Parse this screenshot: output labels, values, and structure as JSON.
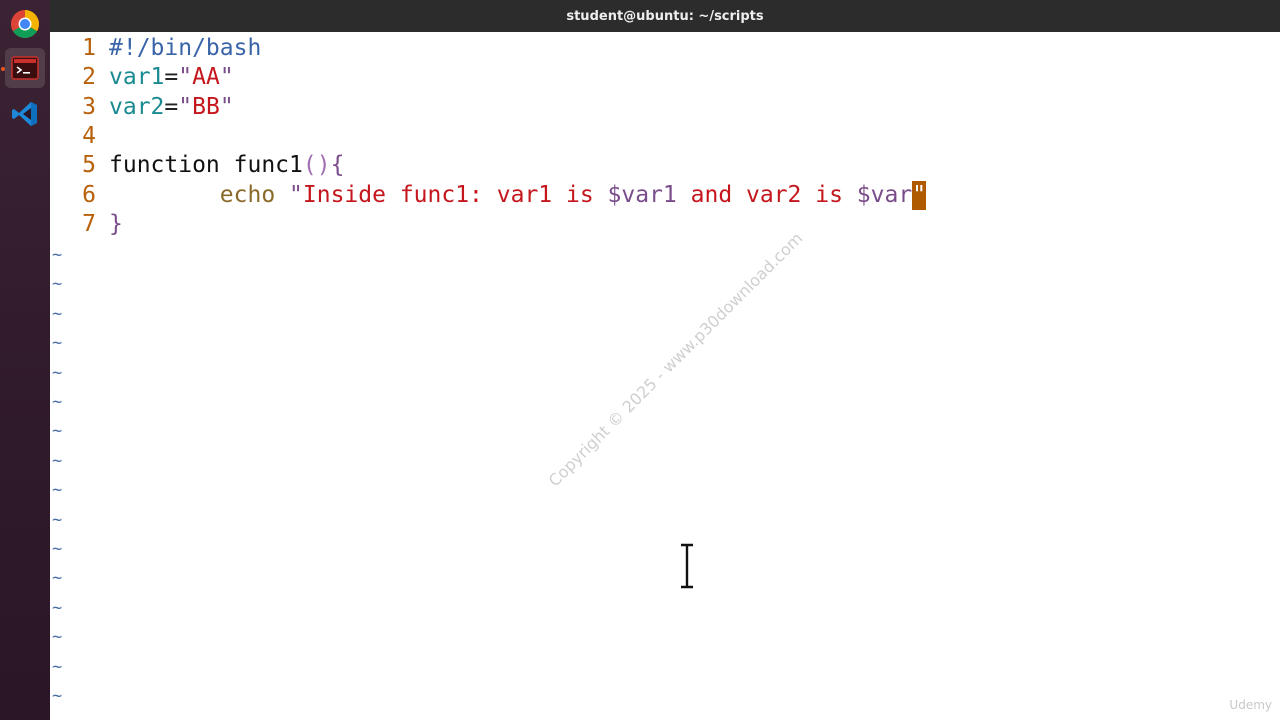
{
  "window": {
    "title": "student@ubuntu: ~/scripts"
  },
  "dock": {
    "items": [
      {
        "name": "Chrome",
        "icon": "chrome-icon"
      },
      {
        "name": "Terminal",
        "icon": "terminal-icon",
        "active": true
      },
      {
        "name": "Visual Studio Code",
        "icon": "vscode-icon"
      }
    ]
  },
  "editor": {
    "lines": [
      {
        "number": "1",
        "tokens": [
          {
            "text": "#!/bin/bash",
            "cls": "c-comment"
          }
        ]
      },
      {
        "number": "2",
        "tokens": [
          {
            "text": "var1",
            "cls": "c-var"
          },
          {
            "text": "=",
            "cls": "c-op"
          },
          {
            "text": "\"",
            "cls": "c-quote"
          },
          {
            "text": "AA",
            "cls": "c-str"
          },
          {
            "text": "\"",
            "cls": "c-quote"
          }
        ]
      },
      {
        "number": "3",
        "tokens": [
          {
            "text": "var2",
            "cls": "c-var"
          },
          {
            "text": "=",
            "cls": "c-op"
          },
          {
            "text": "\"",
            "cls": "c-quote"
          },
          {
            "text": "BB",
            "cls": "c-str"
          },
          {
            "text": "\"",
            "cls": "c-quote"
          }
        ]
      },
      {
        "number": "4",
        "tokens": []
      },
      {
        "number": "5",
        "tokens": [
          {
            "text": "function func1",
            "cls": "c-plain"
          },
          {
            "text": "()",
            "cls": "c-paren"
          },
          {
            "text": "{",
            "cls": "c-brace"
          }
        ]
      },
      {
        "number": "6",
        "tokens": [
          {
            "text": "        ",
            "cls": "c-plain"
          },
          {
            "text": "echo",
            "cls": "c-echo"
          },
          {
            "text": " ",
            "cls": "c-plain"
          },
          {
            "text": "\"",
            "cls": "c-quote"
          },
          {
            "text": "Inside func1: var1 is ",
            "cls": "c-str"
          },
          {
            "text": "$var1",
            "cls": "c-dollar"
          },
          {
            "text": " and var2 is ",
            "cls": "c-str"
          },
          {
            "text": "$var",
            "cls": "c-dollar"
          },
          {
            "text": "\"",
            "cls": "cursor"
          }
        ]
      },
      {
        "number": "7",
        "tokens": [
          {
            "text": "}",
            "cls": "c-brace"
          }
        ]
      }
    ],
    "empty_line_marker": "~",
    "empty_line_count": 16
  },
  "watermark": "Copyright © 2025 - www.p30download.com",
  "brand": "Udemy",
  "colors": {
    "line_number": "#b8600a",
    "cursor": "#b05a00",
    "titlebar": "#2c2c2c",
    "dock": "#3c2333"
  }
}
